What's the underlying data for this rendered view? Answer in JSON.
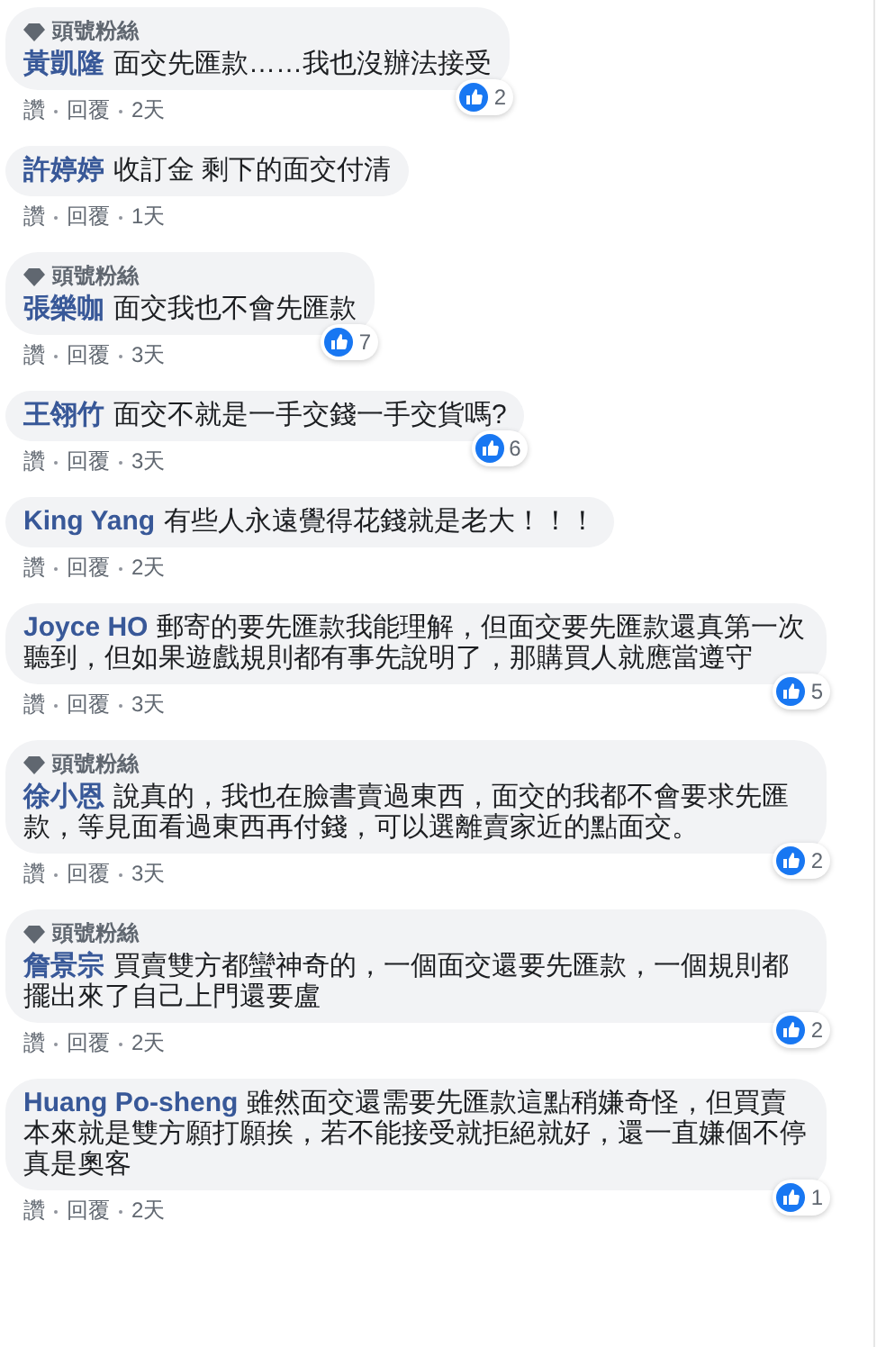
{
  "comments": [
    {
      "badge": "頭號粉絲",
      "name": "黃凱隆",
      "text": "面交先匯款……我也沒辦法接受",
      "likes": "2",
      "actions": [
        "讚",
        "回覆",
        "2天"
      ]
    },
    {
      "name": "許婷婷",
      "text": "收訂金 剩下的面交付清",
      "actions": [
        "讚",
        "回覆",
        "1天"
      ]
    },
    {
      "badge": "頭號粉絲",
      "name": "張樂咖",
      "text": "面交我也不會先匯款",
      "likes": "7",
      "actions": [
        "讚",
        "回覆",
        "3天"
      ]
    },
    {
      "name": "王翎竹",
      "text": "面交不就是一手交錢一手交貨嗎?",
      "likes": "6",
      "actions": [
        "讚",
        "回覆",
        "3天"
      ]
    },
    {
      "name": "King Yang",
      "text": "有些人永遠覺得花錢就是老大！！！",
      "actions": [
        "讚",
        "回覆",
        "2天"
      ]
    },
    {
      "name": "Joyce HO",
      "text": "郵寄的要先匯款我能理解，但面交要先匯款還真第一次聽到，但如果遊戲規則都有事先說明了，那購買人就應當遵守",
      "likes": "5",
      "actions": [
        "讚",
        "回覆",
        "3天"
      ]
    },
    {
      "badge": "頭號粉絲",
      "name": "徐小恩",
      "text": "說真的，我也在臉書賣過東西，面交的我都不會要求先匯款，等見面看過東西再付錢，可以選離賣家近的點面交。",
      "likes": "2",
      "actions": [
        "讚",
        "回覆",
        "3天"
      ]
    },
    {
      "badge": "頭號粉絲",
      "name": "詹景宗",
      "text": "買賣雙方都蠻神奇的，一個面交還要先匯款，一個規則都擺出來了自己上門還要盧",
      "likes": "2",
      "actions": [
        "讚",
        "回覆",
        "2天"
      ]
    },
    {
      "name": "Huang Po-sheng",
      "text": "雖然面交還需要先匯款這點稍嫌奇怪，但買賣本來就是雙方願打願挨，若不能接受就拒絕就好，還一直嫌個不停真是奧客",
      "likes": "1",
      "actions": [
        "讚",
        "回覆",
        "2天"
      ]
    }
  ]
}
